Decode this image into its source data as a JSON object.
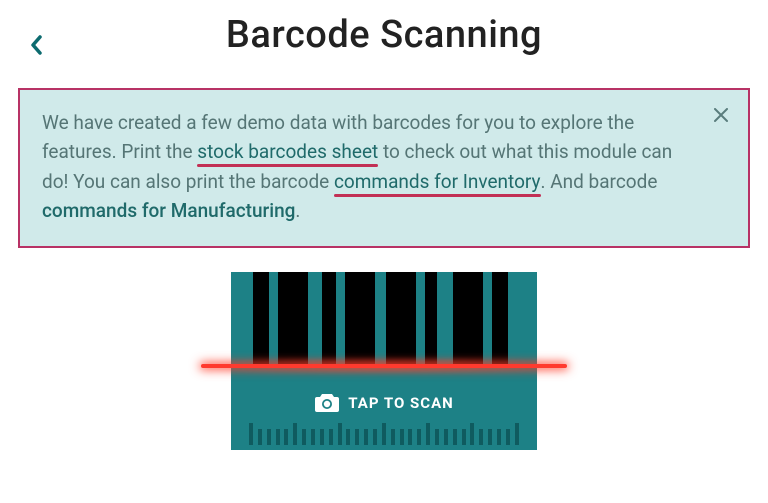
{
  "header": {
    "title": "Barcode Scanning"
  },
  "infobox": {
    "text_1": "We have created a few demo data with barcodes for you to explore the features. Print the ",
    "link_1": "stock barcodes sheet",
    "text_2": " to check out what this module can do! You can also print the barcode ",
    "link_2": "commands for Inventory",
    "text_3": ". And barcode ",
    "link_3": "commands for Manufacturing",
    "text_4": "."
  },
  "scanner": {
    "tap_label": "TAP TO SCAN"
  },
  "icons": {
    "back": "chevron-left-icon",
    "close": "close-icon",
    "camera": "camera-icon"
  },
  "colors": {
    "info_bg": "#d0eaea",
    "info_border": "#b83265",
    "scanner_bg": "#1d8186",
    "scan_line": "#ff3a2e"
  }
}
